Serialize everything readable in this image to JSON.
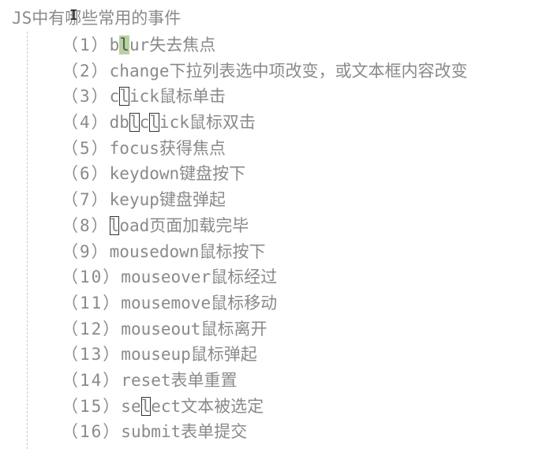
{
  "editor": {
    "title": "JS中有哪些常用的事件",
    "cursor_glyph": "I",
    "lines": [
      {
        "num": "（1）",
        "parts": [
          {
            "t": "b",
            "s": ""
          },
          {
            "t": "l",
            "s": "hl"
          },
          {
            "t": "ur失去焦点",
            "s": ""
          }
        ]
      },
      {
        "num": "（2）",
        "parts": [
          {
            "t": "change下拉列表选中项改变，或文本框内容改变",
            "s": ""
          }
        ]
      },
      {
        "num": "（3）",
        "parts": [
          {
            "t": "c",
            "s": ""
          },
          {
            "t": "l",
            "s": "box"
          },
          {
            "t": "ick鼠标单击",
            "s": ""
          }
        ]
      },
      {
        "num": "（4）",
        "parts": [
          {
            "t": "db",
            "s": ""
          },
          {
            "t": "l",
            "s": "box"
          },
          {
            "t": "c",
            "s": ""
          },
          {
            "t": "l",
            "s": "box"
          },
          {
            "t": "ick鼠标双击",
            "s": ""
          }
        ]
      },
      {
        "num": "（5）",
        "parts": [
          {
            "t": "focus获得焦点",
            "s": ""
          }
        ]
      },
      {
        "num": "（6）",
        "parts": [
          {
            "t": "keydown键盘按下",
            "s": ""
          }
        ]
      },
      {
        "num": "（7）",
        "parts": [
          {
            "t": "keyup键盘弹起",
            "s": ""
          }
        ]
      },
      {
        "num": "（8）",
        "parts": [
          {
            "t": "l",
            "s": "box"
          },
          {
            "t": "oad页面加载完毕",
            "s": ""
          }
        ]
      },
      {
        "num": "（9）",
        "parts": [
          {
            "t": "mousedown鼠标按下",
            "s": ""
          }
        ]
      },
      {
        "num": "（10）",
        "parts": [
          {
            "t": "mouseover鼠标经过",
            "s": ""
          }
        ]
      },
      {
        "num": "（11）",
        "parts": [
          {
            "t": "mousemove鼠标移动",
            "s": ""
          }
        ]
      },
      {
        "num": "（12）",
        "parts": [
          {
            "t": "mouseout鼠标离开",
            "s": ""
          }
        ]
      },
      {
        "num": "（13）",
        "parts": [
          {
            "t": "mouseup鼠标弹起",
            "s": ""
          }
        ]
      },
      {
        "num": "（14）",
        "parts": [
          {
            "t": "reset表单重置",
            "s": ""
          }
        ]
      },
      {
        "num": "（15）",
        "parts": [
          {
            "t": "se",
            "s": ""
          },
          {
            "t": "l",
            "s": "box"
          },
          {
            "t": "ect文本被选定",
            "s": ""
          }
        ]
      },
      {
        "num": "（16）",
        "parts": [
          {
            "t": "submit表单提交",
            "s": ""
          }
        ]
      }
    ]
  }
}
